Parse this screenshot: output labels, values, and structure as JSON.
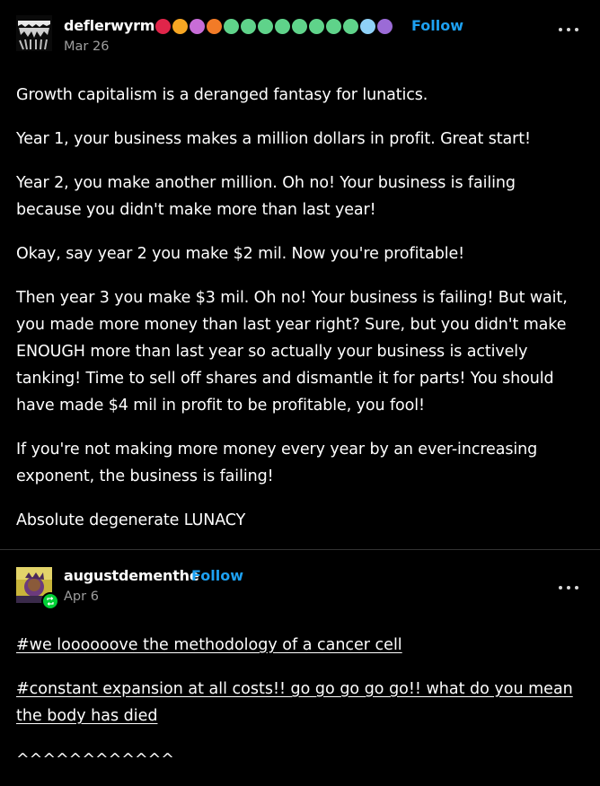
{
  "post": {
    "username": "deflerwyrm",
    "follow_label": "Follow",
    "date": "Mar 26",
    "paragraphs": [
      "Growth capitalism is a deranged fantasy for lunatics.",
      "Year 1, your business makes a million dollars in profit. Great start!",
      "Year 2, you make another million. Oh no! Your business is failing because you didn't make more than last year!",
      "Okay, say year 2 you make $2 mil. Now you're profitable!",
      "Then year 3 you make $3 mil. Oh no! Your business is failing! But wait, you made more money than last year right? Sure, but you didn't make ENOUGH more than last year so actually your business is actively tanking! Time to sell off shares and dismantle it for parts! You should have made $4 mil in profit to be profitable, you fool!",
      "If you're not making more money every year by an ever-increasing exponent, the business is failing!",
      "Absolute degenerate LUNACY"
    ],
    "badges": [
      "#e0254a",
      "#f6a623",
      "#c86dd7",
      "#f27b27",
      "#5fd38a",
      "#5fd38a",
      "#5fd38a",
      "#5fd38a",
      "#5fd38a",
      "#5fd38a",
      "#5fd38a",
      "#5fd38a",
      "#8fd1f7",
      "#9b6bd6"
    ]
  },
  "reblog": {
    "username": "augustdementhe",
    "follow_label": "Follow",
    "date": "Apr 6",
    "tags": [
      "#we loooooove the methodology of a cancer cell",
      "#constant expansion at all costs!! go go go go go!! what do you mean the body has died"
    ],
    "trailing_text": "^^^^^^^^^^^^"
  },
  "colors": {
    "background": "#000000",
    "text": "#ffffff",
    "follow": "#1da1f2",
    "date": "#9e9e9e",
    "divider": "#333333",
    "reblog_badge": "#00cf35"
  },
  "icons": {
    "menu": "more-horizontal-icon",
    "reblog": "reblog-icon"
  }
}
